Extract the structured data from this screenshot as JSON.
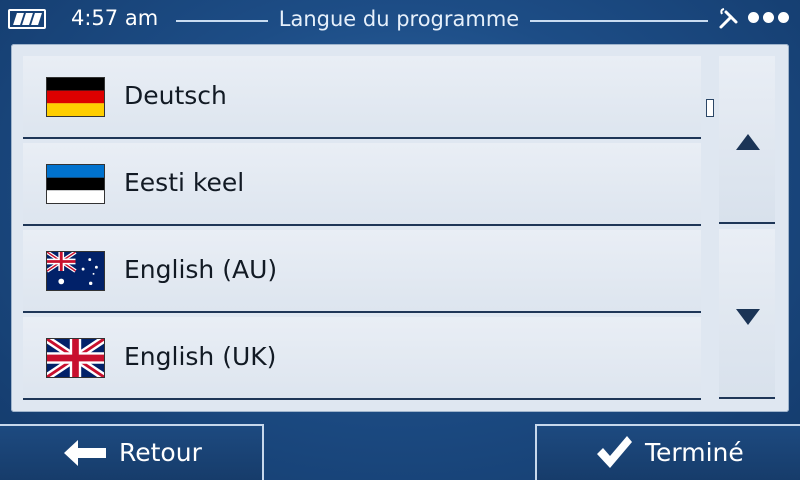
{
  "status": {
    "time": "4:57 am",
    "title": "Langue du programme"
  },
  "languages": [
    {
      "label": "Deutsch",
      "flag": "flag-germany-icon"
    },
    {
      "label": "Eesti keel",
      "flag": "flag-estonia-icon"
    },
    {
      "label": "English (AU)",
      "flag": "flag-australia-icon"
    },
    {
      "label": "English (UK)",
      "flag": "flag-uk-icon"
    }
  ],
  "buttons": {
    "back_label": "Retour",
    "done_label": "Terminé"
  },
  "colors": {
    "background": "#1d4d86",
    "panel": "#dfe7f1",
    "item_text": "#121a24",
    "accent_dark": "#1b3456"
  }
}
